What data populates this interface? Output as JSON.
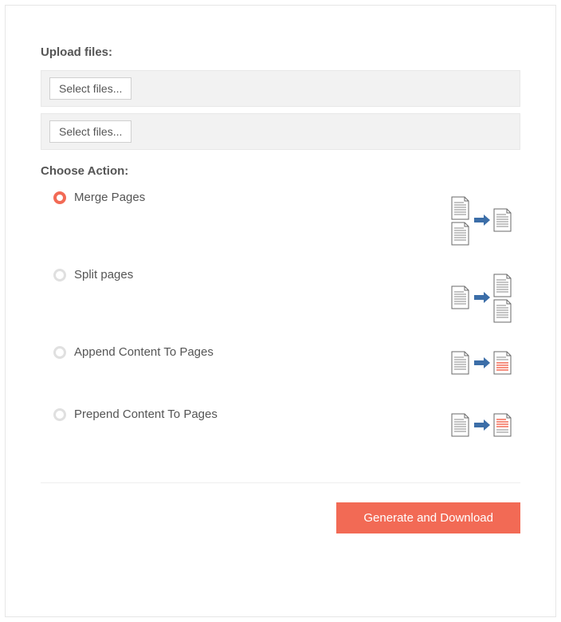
{
  "upload": {
    "label": "Upload files:",
    "button": "Select files..."
  },
  "choose": {
    "label": "Choose Action:",
    "actions": [
      {
        "label": "Merge Pages",
        "selected": true
      },
      {
        "label": "Split pages",
        "selected": false
      },
      {
        "label": "Append Content To Pages",
        "selected": false
      },
      {
        "label": "Prepend Content To Pages",
        "selected": false
      }
    ]
  },
  "submit": {
    "label": "Generate and Download"
  },
  "colors": {
    "accent": "#f26a55",
    "arrow": "#3c6ea8",
    "doc_stroke": "#6a6a6a",
    "doc_line": "#888"
  }
}
